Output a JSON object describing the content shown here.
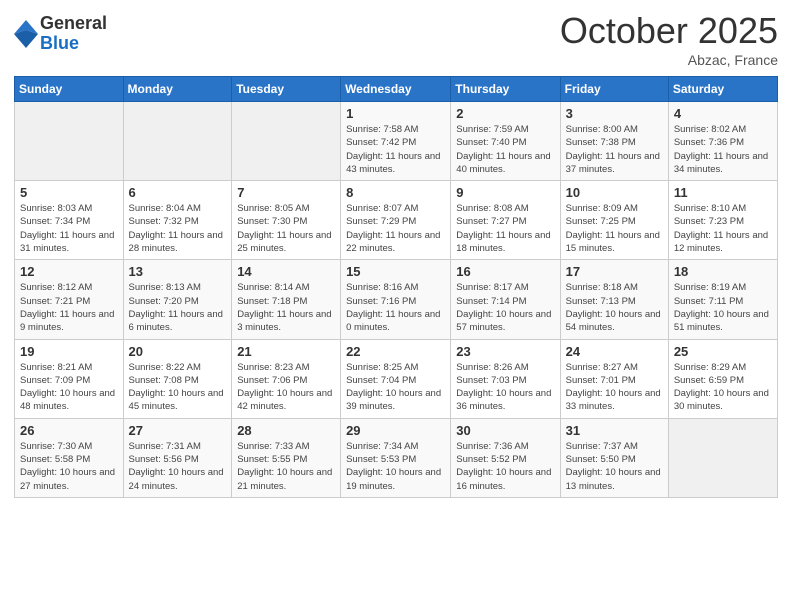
{
  "logo": {
    "general": "General",
    "blue": "Blue"
  },
  "header": {
    "title": "October 2025",
    "location": "Abzac, France"
  },
  "days": [
    "Sunday",
    "Monday",
    "Tuesday",
    "Wednesday",
    "Thursday",
    "Friday",
    "Saturday"
  ],
  "weeks": [
    [
      null,
      null,
      null,
      {
        "day": 1,
        "sunrise": "7:58 AM",
        "sunset": "7:42 PM",
        "daylight": "11 hours and 43 minutes."
      },
      {
        "day": 2,
        "sunrise": "7:59 AM",
        "sunset": "7:40 PM",
        "daylight": "11 hours and 40 minutes."
      },
      {
        "day": 3,
        "sunrise": "8:00 AM",
        "sunset": "7:38 PM",
        "daylight": "11 hours and 37 minutes."
      },
      {
        "day": 4,
        "sunrise": "8:02 AM",
        "sunset": "7:36 PM",
        "daylight": "11 hours and 34 minutes."
      }
    ],
    [
      {
        "day": 5,
        "sunrise": "8:03 AM",
        "sunset": "7:34 PM",
        "daylight": "11 hours and 31 minutes."
      },
      {
        "day": 6,
        "sunrise": "8:04 AM",
        "sunset": "7:32 PM",
        "daylight": "11 hours and 28 minutes."
      },
      {
        "day": 7,
        "sunrise": "8:05 AM",
        "sunset": "7:30 PM",
        "daylight": "11 hours and 25 minutes."
      },
      {
        "day": 8,
        "sunrise": "8:07 AM",
        "sunset": "7:29 PM",
        "daylight": "11 hours and 22 minutes."
      },
      {
        "day": 9,
        "sunrise": "8:08 AM",
        "sunset": "7:27 PM",
        "daylight": "11 hours and 18 minutes."
      },
      {
        "day": 10,
        "sunrise": "8:09 AM",
        "sunset": "7:25 PM",
        "daylight": "11 hours and 15 minutes."
      },
      {
        "day": 11,
        "sunrise": "8:10 AM",
        "sunset": "7:23 PM",
        "daylight": "11 hours and 12 minutes."
      }
    ],
    [
      {
        "day": 12,
        "sunrise": "8:12 AM",
        "sunset": "7:21 PM",
        "daylight": "11 hours and 9 minutes."
      },
      {
        "day": 13,
        "sunrise": "8:13 AM",
        "sunset": "7:20 PM",
        "daylight": "11 hours and 6 minutes."
      },
      {
        "day": 14,
        "sunrise": "8:14 AM",
        "sunset": "7:18 PM",
        "daylight": "11 hours and 3 minutes."
      },
      {
        "day": 15,
        "sunrise": "8:16 AM",
        "sunset": "7:16 PM",
        "daylight": "11 hours and 0 minutes."
      },
      {
        "day": 16,
        "sunrise": "8:17 AM",
        "sunset": "7:14 PM",
        "daylight": "10 hours and 57 minutes."
      },
      {
        "day": 17,
        "sunrise": "8:18 AM",
        "sunset": "7:13 PM",
        "daylight": "10 hours and 54 minutes."
      },
      {
        "day": 18,
        "sunrise": "8:19 AM",
        "sunset": "7:11 PM",
        "daylight": "10 hours and 51 minutes."
      }
    ],
    [
      {
        "day": 19,
        "sunrise": "8:21 AM",
        "sunset": "7:09 PM",
        "daylight": "10 hours and 48 minutes."
      },
      {
        "day": 20,
        "sunrise": "8:22 AM",
        "sunset": "7:08 PM",
        "daylight": "10 hours and 45 minutes."
      },
      {
        "day": 21,
        "sunrise": "8:23 AM",
        "sunset": "7:06 PM",
        "daylight": "10 hours and 42 minutes."
      },
      {
        "day": 22,
        "sunrise": "8:25 AM",
        "sunset": "7:04 PM",
        "daylight": "10 hours and 39 minutes."
      },
      {
        "day": 23,
        "sunrise": "8:26 AM",
        "sunset": "7:03 PM",
        "daylight": "10 hours and 36 minutes."
      },
      {
        "day": 24,
        "sunrise": "8:27 AM",
        "sunset": "7:01 PM",
        "daylight": "10 hours and 33 minutes."
      },
      {
        "day": 25,
        "sunrise": "8:29 AM",
        "sunset": "6:59 PM",
        "daylight": "10 hours and 30 minutes."
      }
    ],
    [
      {
        "day": 26,
        "sunrise": "7:30 AM",
        "sunset": "5:58 PM",
        "daylight": "10 hours and 27 minutes."
      },
      {
        "day": 27,
        "sunrise": "7:31 AM",
        "sunset": "5:56 PM",
        "daylight": "10 hours and 24 minutes."
      },
      {
        "day": 28,
        "sunrise": "7:33 AM",
        "sunset": "5:55 PM",
        "daylight": "10 hours and 21 minutes."
      },
      {
        "day": 29,
        "sunrise": "7:34 AM",
        "sunset": "5:53 PM",
        "daylight": "10 hours and 19 minutes."
      },
      {
        "day": 30,
        "sunrise": "7:36 AM",
        "sunset": "5:52 PM",
        "daylight": "10 hours and 16 minutes."
      },
      {
        "day": 31,
        "sunrise": "7:37 AM",
        "sunset": "5:50 PM",
        "daylight": "10 hours and 13 minutes."
      },
      null
    ]
  ]
}
